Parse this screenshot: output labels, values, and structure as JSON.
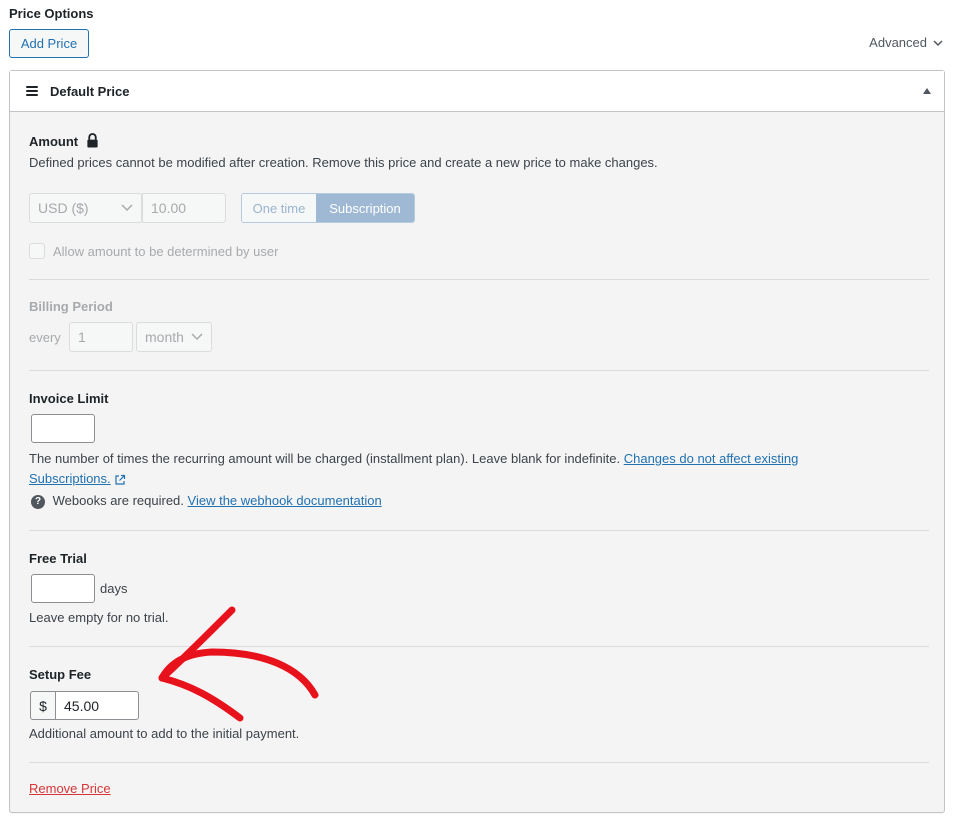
{
  "section": {
    "title": "Price Options"
  },
  "toolbar": {
    "add_price_label": "Add Price",
    "advanced_label": "Advanced"
  },
  "panel": {
    "title": "Default Price",
    "amount": {
      "label": "Amount",
      "description": "Defined prices cannot be modified after creation. Remove this price and create a new price to make changes.",
      "currency": "USD ($)",
      "value": "10.00",
      "type_options": [
        "One time",
        "Subscription"
      ],
      "selected_type": "Subscription",
      "user_defined_label": "Allow amount to be determined by user"
    },
    "billing_period": {
      "label": "Billing Period",
      "prefix": "every",
      "interval": "1",
      "unit": "month"
    },
    "invoice_limit": {
      "label": "Invoice Limit",
      "value": "",
      "description": "The number of times the recurring amount will be charged (installment plan). Leave blank for indefinite.",
      "link_text_1": "Changes do not affect existing",
      "link_text_2": "Subscriptions.",
      "webhook_text": "Webooks are required.",
      "webhook_link": "View the webhook documentation"
    },
    "free_trial": {
      "label": "Free Trial",
      "value": "",
      "suffix": "days",
      "description": "Leave empty for no trial."
    },
    "setup_fee": {
      "label": "Setup Fee",
      "prefix": "$",
      "value": "45.00",
      "description": "Additional amount to add to the initial payment."
    },
    "remove_label": "Remove Price"
  },
  "colors": {
    "accent": "#2271b1",
    "danger": "#d63638",
    "annotation": "#e8121c"
  }
}
